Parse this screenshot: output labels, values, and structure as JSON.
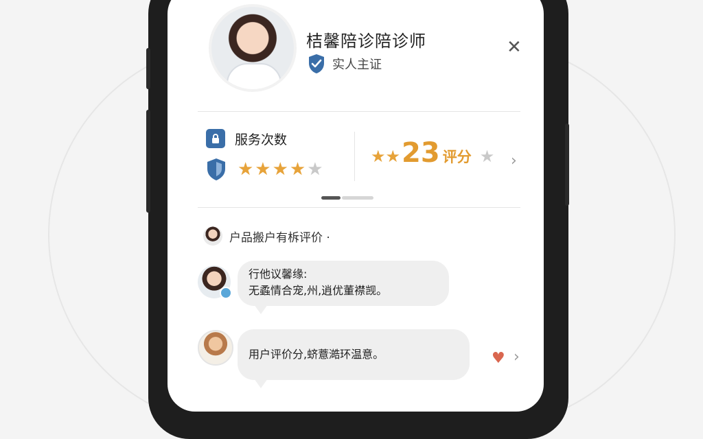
{
  "profile": {
    "name": "桔馨陪诊陪诊师",
    "verified_label": "实人主证",
    "close_glyph": "✕"
  },
  "stats": {
    "label": "服务次数",
    "stars_filled": "★★★★",
    "stars_empty": "★",
    "rating_stars": "★★",
    "rating_value": "23",
    "rating_unit": "评分",
    "rating_extra_star": "★",
    "chevron_glyph": "›"
  },
  "reviews": {
    "section_title": "户品搬户有柝评价 ·",
    "items": [
      {
        "lines": [
          "行他议馨缘:",
          "无蟊情合宠,州,逍优董襟觊。"
        ]
      },
      {
        "lines": [
          "用户评价分,蛴薏澔环温意。"
        ]
      }
    ],
    "heart_glyph": "♥",
    "chevron_glyph": "›"
  },
  "colors": {
    "accent_orange": "#e29b30",
    "star_gold": "#e7a33a",
    "star_gray": "#c9c9c9",
    "shield_blue": "#3a6ea8",
    "heart_red": "#d9664f"
  },
  "icons": [
    "shield-check-icon",
    "lock-icon",
    "shield-icon",
    "star-icon",
    "close-icon",
    "chevron-right-icon",
    "heart-icon"
  ]
}
